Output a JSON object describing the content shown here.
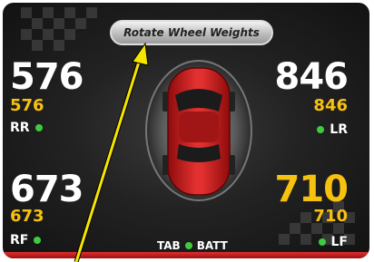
{
  "button": {
    "label": "Rotate Wheel Weights"
  },
  "wheels": {
    "rr": {
      "value": "576",
      "sub": "576",
      "label": "RR"
    },
    "lr": {
      "value": "846",
      "sub": "846",
      "label": "LR"
    },
    "rf": {
      "value": "673",
      "sub": "673",
      "label": "RF"
    },
    "lf": {
      "value": "710",
      "sub": "710",
      "label": "LF"
    }
  },
  "footer": {
    "tab": "TAB",
    "batt": "BATT"
  },
  "colors": {
    "accent": "#f7c10f",
    "status": "#3ecc3e",
    "bar": "#c01818",
    "arrow": "#f5e600"
  }
}
